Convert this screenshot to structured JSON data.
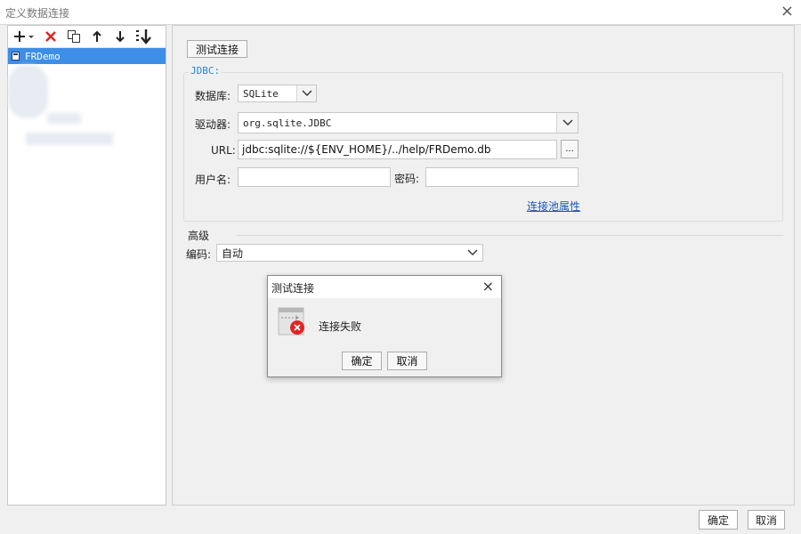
{
  "window": {
    "title": "定义数据连接",
    "close_icon": "×"
  },
  "left": {
    "toolbar": [
      "add-icon",
      "delete-icon",
      "copy-icon",
      "move-up-icon",
      "move-down-icon",
      "sort-icon"
    ],
    "items": [
      {
        "label": "FRDemo"
      }
    ]
  },
  "right": {
    "test_button": "测试连接",
    "group_label": "JDBC:",
    "database_label": "数据库:",
    "database_value": "SQLite",
    "driver_label": "驱动器:",
    "driver_value": "org.sqlite.JDBC",
    "url_label": "URL:",
    "url_value": "jdbc:sqlite://${ENV_HOME}/../help/FRDemo.db",
    "url_browse": "...",
    "username_label": "用户名:",
    "password_label": "密码:",
    "pool_link": "连接池属性",
    "advanced_label": "高级",
    "encoding_label": "编码:",
    "encoding_value": "自动"
  },
  "modal": {
    "title": "测试连接",
    "close_icon": "×",
    "message": "连接失败",
    "ok": "确定",
    "cancel": "取消"
  },
  "footer": {
    "ok": "确定",
    "cancel": "取消"
  },
  "colors": {
    "selection": "#3d8ee6",
    "jdbc_label": "#2a86c9",
    "link": "#1a56b8",
    "error": "#e02424"
  }
}
